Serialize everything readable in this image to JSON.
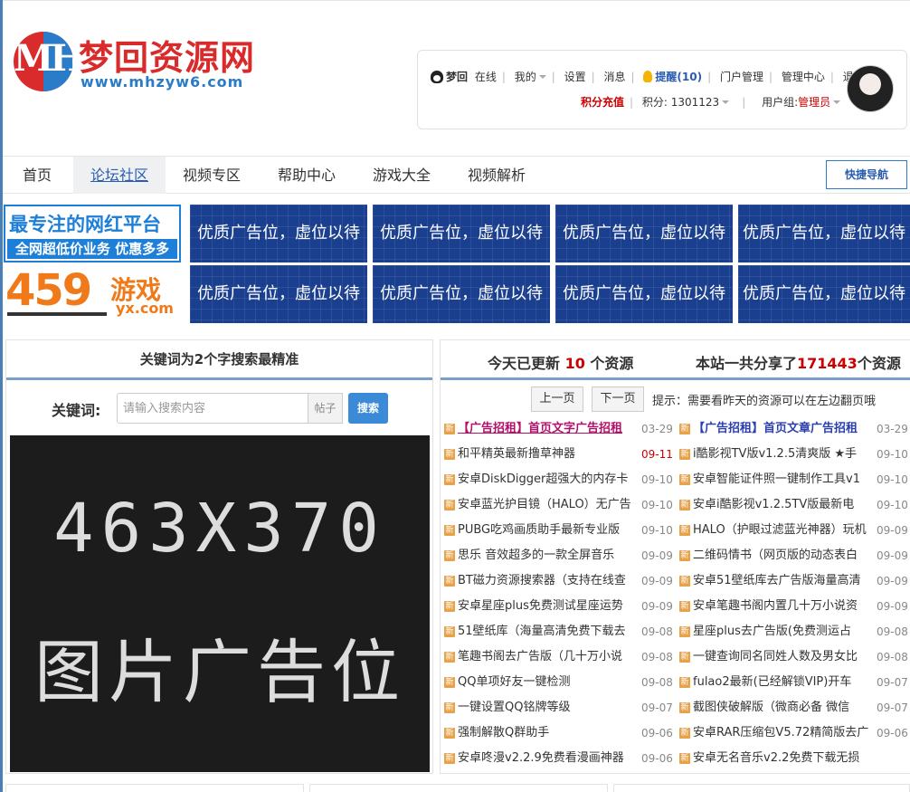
{
  "site": {
    "logo_mark": "MH",
    "title": "梦回资源网",
    "url": "www.mhzyw6.com"
  },
  "user": {
    "name": "梦回",
    "status": "在线",
    "my": "我的",
    "links": [
      "设置",
      "消息"
    ],
    "remind": "提醒(10)",
    "links2": [
      "门户管理",
      "管理中心",
      "退出"
    ],
    "recharge": "积分充值",
    "points_label": "积分: 1301123",
    "group_label": "用户组: ",
    "group_value": "管理员"
  },
  "nav": {
    "items": [
      "首页",
      "论坛社区",
      "视频专区",
      "帮助中心",
      "游戏大全",
      "视频解析"
    ],
    "active": "论坛社区",
    "quick": "快捷导航"
  },
  "ads": {
    "ad1_line1": "最专注的网红平台",
    "ad1_line2": "全网超低价业务 优惠多多",
    "ad2_num": "459",
    "ad2_word": "游戏",
    "ad2_com": "yx.com",
    "slot_text": "优质广告位，虚位以待"
  },
  "search": {
    "title": "关键词为2个字搜索最精准",
    "label": "关键词:",
    "placeholder": "请输入搜索内容",
    "type": "帖子",
    "button": "搜索",
    "ad_size": "463X370",
    "ad_caption": "图片广告位"
  },
  "resources": {
    "today_prefix": "今天已更新 ",
    "today_count": "10",
    "today_suffix": " 个资源",
    "total_prefix": "本站一共分享了",
    "total_count": "171443",
    "total_suffix": "个资源",
    "prev": "上一页",
    "next": "下一页",
    "hint": "提示：需要看昨天的资源可以在左边翻页哦",
    "new_icon": "新",
    "rows": [
      {
        "l": "【广告招租】首页文字广告招租",
        "ld": "03-29",
        "r": "【广告招租】首页文章广告招租",
        "rd": "03-29"
      },
      {
        "l": "和平精英最新撸草神器",
        "ld": "09-11",
        "r": "i酷影视TV版v1.2.5清爽版 ★手",
        "rd": "09-10"
      },
      {
        "l": "安卓DiskDigger超强大的内存卡",
        "ld": "09-10",
        "r": "安卓智能证件照一键制作工具v1",
        "rd": "09-10"
      },
      {
        "l": "安卓蓝光护目镜（HALO）无广告",
        "ld": "09-10",
        "r": "安卓i酷影视v1.2.5TV版最新电",
        "rd": "09-10"
      },
      {
        "l": "PUBG吃鸡画质助手最新专业版",
        "ld": "09-10",
        "r": "HALO（护眼过滤蓝光神器）玩机",
        "rd": "09-09"
      },
      {
        "l": "思乐 音效超多的一款全屏音乐",
        "ld": "09-09",
        "r": "二维码情书（网页版的动态表白",
        "rd": "09-09"
      },
      {
        "l": "BT磁力资源搜索器（支持在线查",
        "ld": "09-09",
        "r": "安卓51壁纸库去广告版海量高清",
        "rd": "09-09"
      },
      {
        "l": "安卓星座plus免费测试星座运势",
        "ld": "09-09",
        "r": "安卓笔趣书阁内置几十万小说资",
        "rd": "09-09"
      },
      {
        "l": "51壁纸库（海量高清免费下载去",
        "ld": "09-08",
        "r": "星座plus去广告版(免费测运占",
        "rd": "09-08"
      },
      {
        "l": "笔趣书阁去广告版（几十万小说",
        "ld": "09-08",
        "r": "一键查询同名同姓人数及男女比",
        "rd": "09-08"
      },
      {
        "l": "QQ单项好友一键检测",
        "ld": "09-08",
        "r": "fulao2最新(已经解锁VIP)开车",
        "rd": "09-07"
      },
      {
        "l": "一键设置QQ铭牌等级",
        "ld": "09-07",
        "r": "截图侠破解版（微商必备 微信",
        "rd": "09-07"
      },
      {
        "l": "强制解散Q群助手",
        "ld": "09-06",
        "r": "安卓RAR压缩包V5.72精简版去广",
        "rd": "09-06"
      },
      {
        "l": "安卓咚漫v2.2.9免费看漫画神器",
        "ld": "09-06",
        "r": "安卓无名音乐v2.2免费下载无损",
        "rd": ""
      }
    ]
  }
}
